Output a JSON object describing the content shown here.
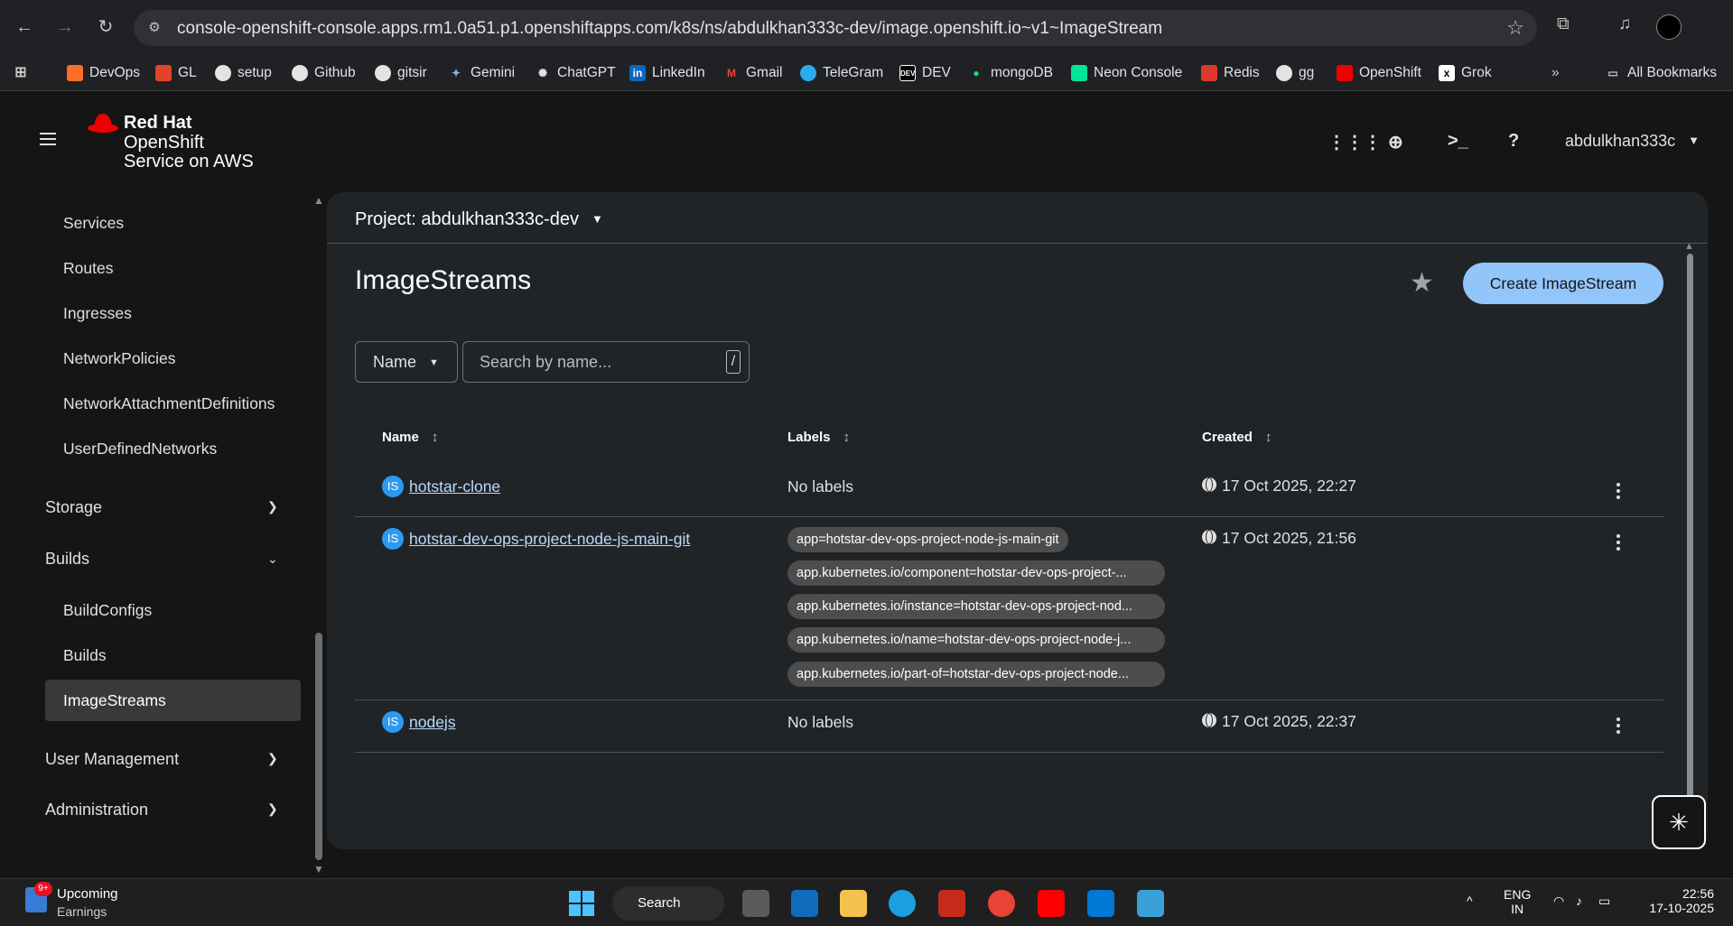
{
  "browser": {
    "url": "console-openshift-console.apps.rm1.0a51.p1.openshiftapps.com/k8s/ns/abdulkhan333c-dev/image.openshift.io~v1~ImageStream",
    "bookmarks": [
      "DevOps",
      "GL",
      "setup",
      "Github",
      "gitsir",
      "Gemini",
      "ChatGPT",
      "LinkedIn",
      "Gmail",
      "TeleGram",
      "DEV",
      "mongoDB",
      "Neon Console",
      "Redis",
      "gg",
      "OpenShift",
      "Grok"
    ],
    "all_bookmarks": "All Bookmarks"
  },
  "masthead": {
    "brand_line1": "Red Hat",
    "brand_line2": "OpenShift",
    "brand_line3": "Service on AWS",
    "user": "abdulkhan333c"
  },
  "sidebar": {
    "network_items": [
      "Services",
      "Routes",
      "Ingresses",
      "NetworkPolicies",
      "NetworkAttachmentDefinitions",
      "UserDefinedNetworks"
    ],
    "storage": "Storage",
    "builds": "Builds",
    "build_items": [
      "BuildConfigs",
      "Builds",
      "ImageStreams"
    ],
    "user_management": "User Management",
    "administration": "Administration"
  },
  "main": {
    "project": "Project: abdulkhan333c-dev",
    "title": "ImageStreams",
    "create_button": "Create ImageStream",
    "filter_select": "Name",
    "search_placeholder": "Search by name...",
    "search_shortcut": "/",
    "columns": [
      "Name",
      "Labels",
      "Created"
    ],
    "badge": "IS",
    "rows": [
      {
        "name": "hotstar-clone",
        "labels": "No labels",
        "created": "17 Oct 2025, 22:27"
      },
      {
        "name": "hotstar-dev-ops-project-node-js-main-git",
        "labels": [
          "app=hotstar-dev-ops-project-node-js-main-git",
          "app.kubernetes.io/component=hotstar-dev-ops-project-...",
          "app.kubernetes.io/instance=hotstar-dev-ops-project-nod...",
          "app.kubernetes.io/name=hotstar-dev-ops-project-node-j...",
          "app.kubernetes.io/part-of=hotstar-dev-ops-project-node..."
        ],
        "created": "17 Oct 2025, 21:56"
      },
      {
        "name": "nodejs",
        "labels": "No labels",
        "created": "17 Oct 2025, 22:37"
      }
    ]
  },
  "taskbar": {
    "badge": "9+",
    "widget_title": "Upcoming",
    "widget_sub": "Earnings",
    "search": "Search",
    "lang_top": "ENG",
    "lang_bottom": "IN",
    "time": "22:56",
    "date": "17-10-2025"
  }
}
